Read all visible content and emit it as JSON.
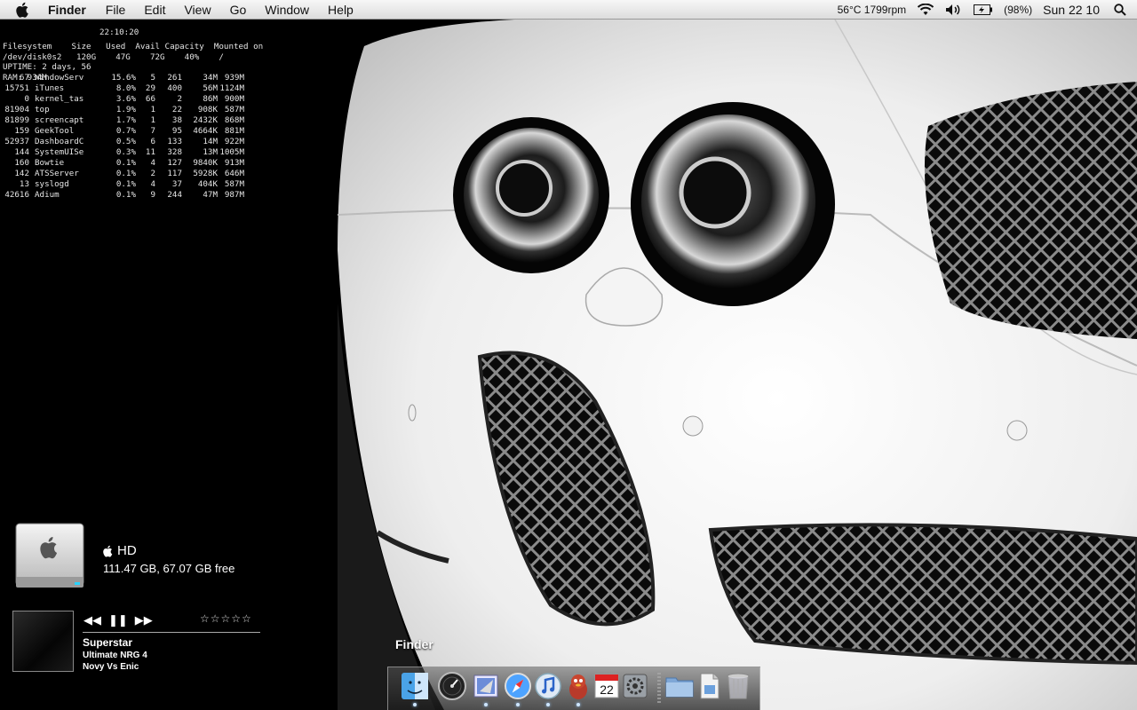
{
  "menubar": {
    "app_name": "Finder",
    "items": [
      "File",
      "Edit",
      "View",
      "Go",
      "Window",
      "Help"
    ],
    "temp_fan": "56°C 1799rpm",
    "battery": "(98%)",
    "clock": "Sun 22 10"
  },
  "geektool": {
    "time": "22:10:20",
    "df_header": "Filesystem    Size   Used  Avail Capacity  Mounted on",
    "df_row": "/dev/disk0s2   120G    47G    72G    40%    /",
    "uptime": "UPTIME: 2 days, 56",
    "ram": "RAM: 934M",
    "processes": [
      [
        "   67",
        "WindowServ",
        "15.6%",
        " 5",
        "261",
        "34M",
        "939M"
      ],
      [
        "15751",
        "iTunes",
        "8.0%",
        "29",
        "400",
        "56M",
        "1124M"
      ],
      [
        "    0",
        "kernel_tas",
        "3.6%",
        "66",
        "2",
        "86M",
        "900M"
      ],
      [
        "81904",
        "top",
        "1.9%",
        " 1",
        "22",
        "908K",
        "587M"
      ],
      [
        "81899",
        "screencapt",
        "1.7%",
        " 1",
        "38",
        "2432K",
        "868M"
      ],
      [
        "  159",
        "GeekTool",
        "0.7%",
        " 7",
        "95",
        "4664K",
        "881M"
      ],
      [
        "52937",
        "DashboardC",
        "0.5%",
        " 6",
        "133",
        "14M",
        "922M"
      ],
      [
        "  144",
        "SystemUISe",
        "0.3%",
        "11",
        "328",
        "13M",
        "1005M"
      ],
      [
        "  160",
        "Bowtie",
        "0.1%",
        " 4",
        "127",
        "9840K",
        "913M"
      ],
      [
        "  142",
        "ATSServer",
        "0.1%",
        " 2",
        "117",
        "5928K",
        "646M"
      ],
      [
        "   13",
        "syslogd",
        "0.1%",
        " 4",
        "37",
        "404K",
        "587M"
      ],
      [
        "42616",
        "Adium",
        "0.1%",
        " 9",
        "244",
        "47M",
        "987M"
      ]
    ]
  },
  "hd_widget": {
    "name": "HD",
    "size": "111.47 GB, 67.07 GB free"
  },
  "music": {
    "track": "Superstar",
    "album": "Ultimate NRG 4",
    "artist": "Novy Vs Enic",
    "stars": "☆☆☆☆☆",
    "prev": "◀◀",
    "pause": "❚❚",
    "next": "▶▶"
  },
  "dock": {
    "label": "Finder",
    "calendar_day": "22"
  }
}
